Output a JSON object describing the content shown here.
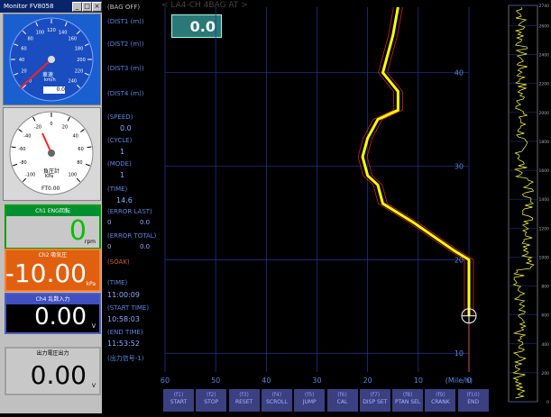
{
  "window": {
    "title": "Monitor FV8058",
    "btn_min": "_",
    "btn_max": "□",
    "btn_close": "×"
  },
  "speed_gauge": {
    "label": "車速",
    "unit": "km/h",
    "readout": "0.0",
    "ticks": [
      "0",
      "20",
      "40",
      "60",
      "80",
      "100",
      "120",
      "140",
      "160",
      "180",
      "200",
      "220",
      "240"
    ]
  },
  "pressure_gauge": {
    "label": "負圧計",
    "unit": "KPa",
    "readout": "FT0.00",
    "ticks": [
      "-100",
      "-80",
      "-60",
      "-40",
      "-20",
      "0",
      "20",
      "40",
      "60",
      "80",
      "100"
    ]
  },
  "displays": [
    {
      "header": "Ch1 ENG回転",
      "value": "0",
      "unit": "rpm",
      "color": "#00c000",
      "bg": "#c8c8c8"
    },
    {
      "header": "Ch2 吸気圧",
      "value": "-10.00",
      "unit": "kPa",
      "color": "#ffffff",
      "bg": "#e06010"
    },
    {
      "header": "Ch4 乱数入力",
      "value": "0.00",
      "unit": "V",
      "color": "#ffffff",
      "bg": "#000000"
    },
    {
      "header": "出力電圧出力",
      "value": "0.00",
      "unit": "V",
      "color": "#000000",
      "bg": "#c8c8c8"
    }
  ],
  "mid": {
    "bag_state": "(BAG OFF)",
    "dist1": "(DIST1 (m))",
    "dist2": "(DIST2 (m))",
    "dist3": "(DIST3 (m))",
    "dist4": "(DIST4 (m))",
    "speed_label": "(SPEED)",
    "speed_value": "0.0",
    "cycle_label": "(CYCLE)",
    "cycle_value": "1",
    "mode_label": "(MODE)",
    "mode_value": "1",
    "time_label": "(TIME)",
    "time_value": "14.6",
    "error_last_label": "(ERROR LAST)",
    "error_last_a": "0",
    "error_last_b": "0.0",
    "error_total_label": "(ERROR TOTAL)",
    "error_total_a": "0",
    "error_total_b": "0.0",
    "soak": "(SOAK)",
    "clock_label": "(TIME)",
    "clock_value": "11:00:09",
    "start_label": "(START TIME)",
    "start_value": "10:58:03",
    "end_label": "(END TIME)",
    "end_value": "11:53:52",
    "output_label": "(出力信号-1)"
  },
  "chart_header": "< LA4-CH 4BAG AT >",
  "dist_readout": "0.0",
  "chart_data": [
    {
      "type": "line",
      "xlabel": "(Mile/h)",
      "x_ticks": [
        "60",
        "50",
        "40",
        "30",
        "20",
        "10",
        "0"
      ],
      "y_ticks": [
        "10",
        "20",
        "30",
        "40"
      ],
      "xlim": [
        60,
        0
      ],
      "ylim": [
        8,
        47
      ],
      "series": [
        {
          "color": "#ffff00",
          "points": [
            [
              0,
              14
            ],
            [
              0,
              20
            ],
            [
              3,
              21
            ],
            [
              11,
              24
            ],
            [
              17,
              26
            ],
            [
              18,
              28
            ],
            [
              20,
              29
            ],
            [
              21,
              31
            ],
            [
              20,
              33
            ],
            [
              18,
              35
            ],
            [
              14,
              36
            ],
            [
              14,
              38
            ],
            [
              17,
              40
            ],
            [
              15,
              44
            ],
            [
              14,
              47
            ]
          ]
        }
      ],
      "marker_point": [
        0,
        14
      ],
      "grid": true
    },
    {
      "type": "line",
      "y_ticks": [
        "0",
        "200",
        "400",
        "600",
        "800",
        "1000",
        "1200",
        "1400",
        "1600",
        "1800",
        "2000",
        "2200",
        "2400",
        "2600",
        "2740"
      ],
      "ylim": [
        0,
        2740
      ],
      "grid": true
    }
  ],
  "buttons": [
    {
      "key": "(f1)",
      "label": "START"
    },
    {
      "key": "(f2)",
      "label": "STOP"
    },
    {
      "key": "(f3)",
      "label": "RESET"
    },
    {
      "key": "(f4)",
      "label": "SCROLL"
    },
    {
      "key": "(f5)",
      "label": "JUMP"
    },
    {
      "key": "(f6)",
      "label": "CAL"
    },
    {
      "key": "(f7)",
      "label": "DISP SET"
    },
    {
      "key": "(f8)",
      "label": "PTAN SEL"
    },
    {
      "key": "(f9)",
      "label": "CRANK"
    },
    {
      "key": "(f10)",
      "label": "END"
    }
  ]
}
